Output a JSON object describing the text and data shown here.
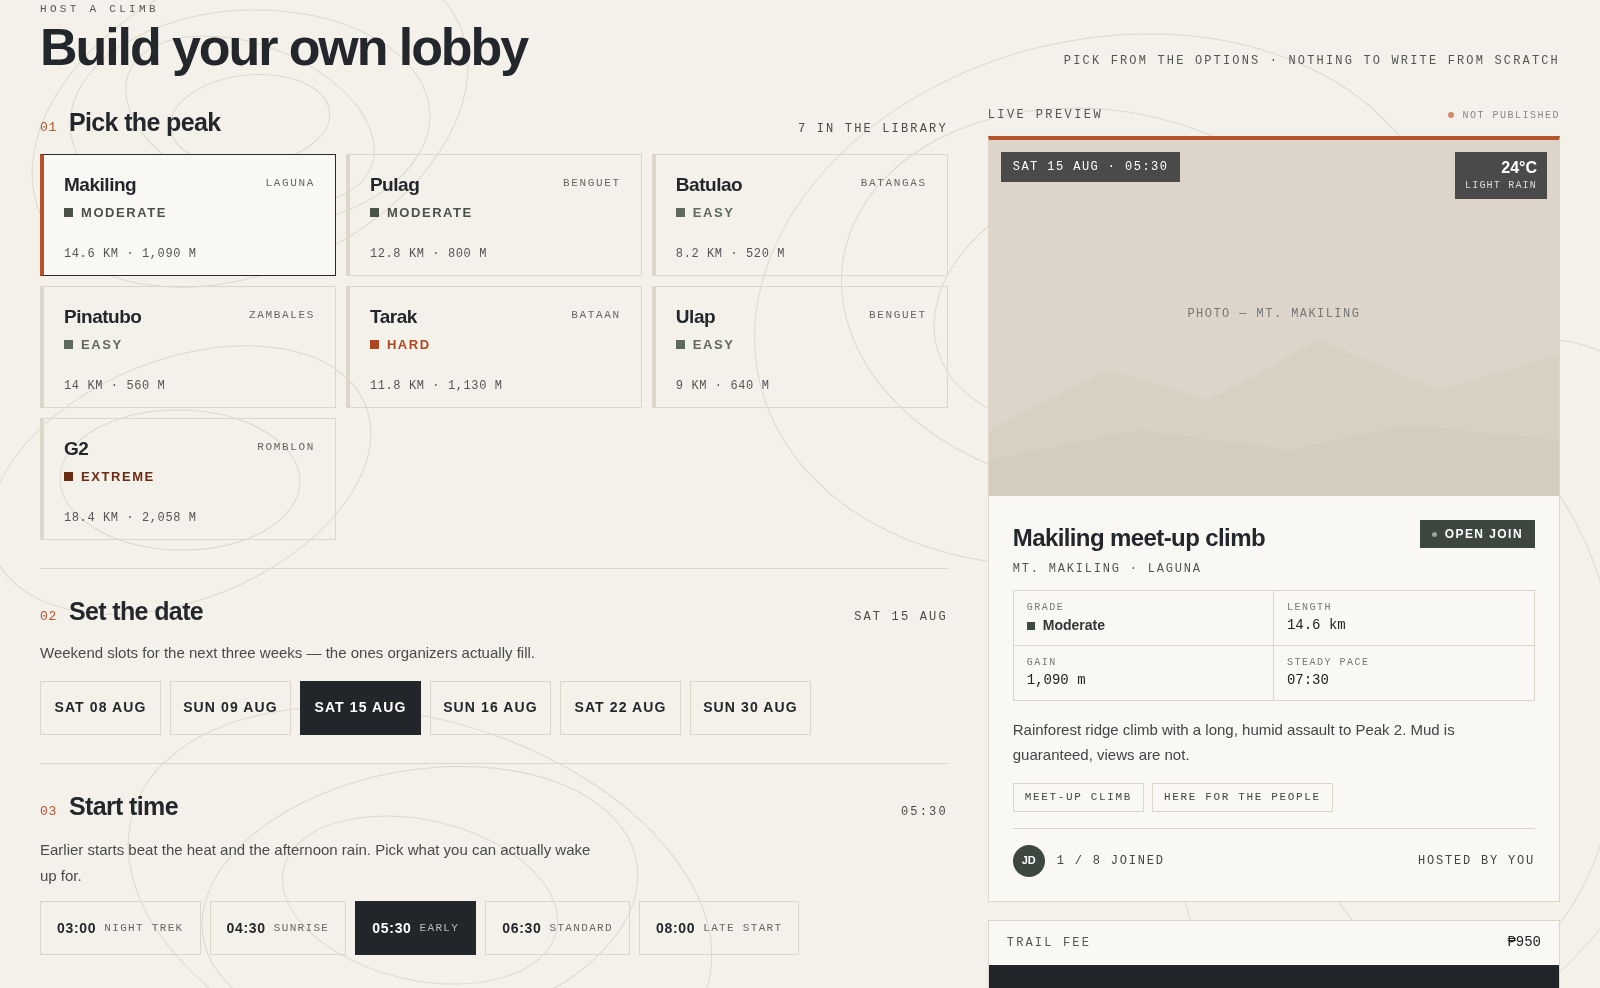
{
  "header": {
    "eyebrow": "HOST A CLIMB",
    "title": "Build your own lobby",
    "tagline": "PICK FROM THE OPTIONS · NOTHING TO WRITE FROM SCRATCH"
  },
  "peak_section": {
    "number": "01",
    "title": "Pick the peak",
    "meta": "7 IN THE LIBRARY",
    "peaks": [
      {
        "name": "Makiling",
        "region": "LAGUNA",
        "grade": "MODERATE",
        "color": "#4a5248",
        "stats": "14.6 KM · 1,090 M",
        "selected": true
      },
      {
        "name": "Pulag",
        "region": "BENGUET",
        "grade": "MODERATE",
        "color": "#4a5248",
        "stats": "12.8 KM · 800 M",
        "selected": false
      },
      {
        "name": "Batulao",
        "region": "BATANGAS",
        "grade": "EASY",
        "color": "#5e6b5c",
        "stats": "8.2 KM · 520 M",
        "selected": false
      },
      {
        "name": "Pinatubo",
        "region": "ZAMBALES",
        "grade": "EASY",
        "color": "#5e6b5c",
        "stats": "14 KM · 560 M",
        "selected": false
      },
      {
        "name": "Tarak",
        "region": "BATAAN",
        "grade": "HARD",
        "color": "#b0461f",
        "stats": "11.8 KM · 1,130 M",
        "selected": false
      },
      {
        "name": "Ulap",
        "region": "BENGUET",
        "grade": "EASY",
        "color": "#5e6b5c",
        "stats": "9 KM · 640 M",
        "selected": false
      },
      {
        "name": "G2",
        "region": "ROMBLON",
        "grade": "EXTREME",
        "color": "#6b2a12",
        "stats": "18.4 KM · 2,058 M",
        "selected": false
      }
    ]
  },
  "date_section": {
    "number": "02",
    "title": "Set the date",
    "meta": "SAT 15 AUG",
    "description": "Weekend slots for the next three weeks — the ones organizers actually fill.",
    "dates": [
      {
        "label": "SAT 08 AUG",
        "selected": false
      },
      {
        "label": "SUN 09 AUG",
        "selected": false
      },
      {
        "label": "SAT 15 AUG",
        "selected": true
      },
      {
        "label": "SUN 16 AUG",
        "selected": false
      },
      {
        "label": "SAT 22 AUG",
        "selected": false
      },
      {
        "label": "SUN 30 AUG",
        "selected": false
      }
    ]
  },
  "time_section": {
    "number": "03",
    "title": "Start time",
    "meta": "05:30",
    "description": "Earlier starts beat the heat and the afternoon rain. Pick what you can actually wake up for.",
    "times": [
      {
        "time": "03:00",
        "label": "NIGHT TREK",
        "selected": false
      },
      {
        "time": "04:30",
        "label": "SUNRISE",
        "selected": false
      },
      {
        "time": "05:30",
        "label": "EARLY",
        "selected": true
      },
      {
        "time": "06:30",
        "label": "STANDARD",
        "selected": false
      },
      {
        "time": "08:00",
        "label": "LATE START",
        "selected": false
      }
    ]
  },
  "preview": {
    "label": "LIVE PREVIEW",
    "status": {
      "label": "NOT PUBLISHED",
      "color": "#d08a6e"
    },
    "photo": {
      "date_badge": "SAT 15 AUG · 05:30",
      "temperature": "24°C",
      "weather": "LIGHT RAIN",
      "caption": "PHOTO — MT. MAKILING"
    },
    "title": "Makiling meet-up climb",
    "badge": "OPEN JOIN",
    "subtitle": "MT. MAKILING · LAGUNA",
    "stats": [
      {
        "label": "GRADE",
        "value": "Moderate",
        "kind": "grade",
        "color": "#3d4a40"
      },
      {
        "label": "LENGTH",
        "value": "14.6 km",
        "kind": "mono"
      },
      {
        "label": "GAIN",
        "value": "1,090 m",
        "kind": "mono"
      },
      {
        "label": "STEADY PACE",
        "value": "07:30",
        "kind": "mono"
      }
    ],
    "description": "Rainforest ridge climb with a long, humid assault to Peak 2. Mud is guaranteed, views are not.",
    "tags": [
      "MEET-UP CLIMB",
      "HERE FOR THE PEOPLE"
    ],
    "avatar": "JD",
    "joined": "1 / 8 JOINED",
    "host": "HOSTED BY YOU"
  },
  "fee": {
    "label": "TRAIL FEE",
    "amount": "₱950"
  }
}
